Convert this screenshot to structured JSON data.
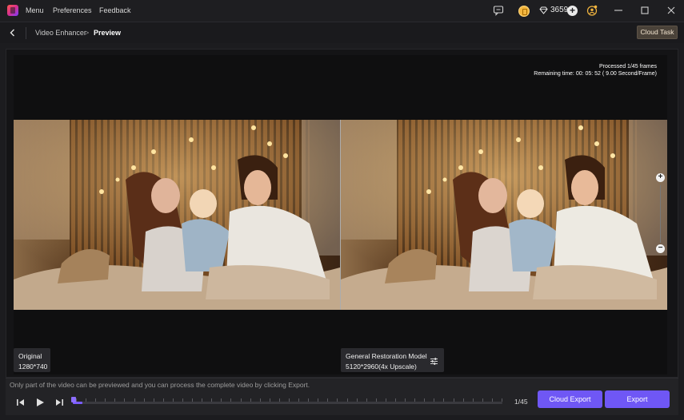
{
  "titlebar": {
    "menu_items": [
      "Menu",
      "Preferences",
      "Feedback"
    ],
    "gem_count": "3659",
    "icons": [
      "app-logo-icon",
      "chat-icon",
      "coin-icon",
      "diamond-icon",
      "add-icon",
      "user-badge-icon",
      "minimize-icon",
      "maximize-icon",
      "close-icon"
    ]
  },
  "header": {
    "breadcrumb_parent": "Video Enhancer",
    "breadcrumb_separator": ">",
    "breadcrumb_current": "Preview",
    "cloud_task_label": "Cloud Task"
  },
  "preview": {
    "processed_text": "Processed 1/45 frames",
    "remaining_text": "Remaining time: 00: 05: 52 ( 9.00 Second/Frame)",
    "original": {
      "title": "Original",
      "resolution": "1280*740"
    },
    "enhanced": {
      "model": "General Restoration Model",
      "resolution": "5120*2960(4x Upscale)"
    },
    "zoom_in_label": "+",
    "zoom_out_label": "−"
  },
  "player": {
    "hint": "Only part of the video can be previewed and you can process the complete video by clicking Export.",
    "frame_counter": "1/45",
    "progress_fraction": 0.022,
    "cloud_export_label": "Cloud Export",
    "export_label": "Export"
  },
  "colors": {
    "accent": "#6f57f5",
    "background": "#1c1c1f",
    "panel": "#232326",
    "cloud_task_bg": "#4a4239"
  }
}
